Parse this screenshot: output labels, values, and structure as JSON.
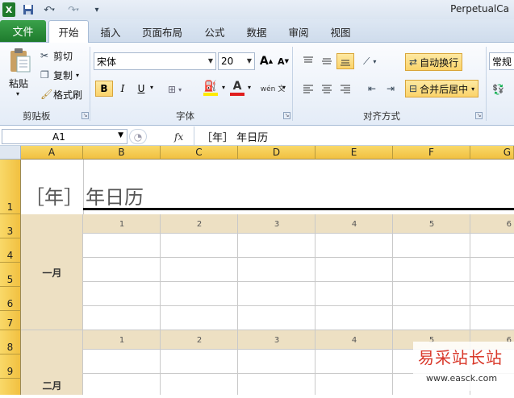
{
  "window": {
    "title": "PerpetualCa"
  },
  "qat": {
    "excel_icon": "excel-icon",
    "save_icon": "save-icon",
    "undo_icon": "undo-icon",
    "redo_icon": "redo-icon",
    "customize_icon": "customize-qat-icon"
  },
  "tabs": {
    "file": "文件",
    "items": [
      "开始",
      "插入",
      "页面布局",
      "公式",
      "数据",
      "审阅",
      "视图"
    ],
    "active": "开始"
  },
  "clipboard": {
    "paste": "粘贴",
    "cut": "剪切",
    "copy": "复制",
    "format_painter": "格式刷",
    "group": "剪贴板"
  },
  "font": {
    "name": "宋体",
    "size": "20",
    "grow": "A",
    "shrink": "A",
    "bold": "B",
    "italic": "I",
    "underline": "U",
    "font_color_letter": "A",
    "phonetic": "wén 文",
    "group": "字体"
  },
  "alignment": {
    "wrap_text": "自动换行",
    "merge_center": "合并后居中",
    "group": "对齐方式"
  },
  "number": {
    "format": "常规"
  },
  "formula_bar": {
    "name_box": "A1",
    "fx": "fx",
    "content": "［年］ 年日历"
  },
  "columns": [
    "A",
    "B",
    "C",
    "D",
    "E",
    "F",
    "G"
  ],
  "rows": [
    "1",
    "3",
    "4",
    "5",
    "6",
    "7",
    "8",
    "9"
  ],
  "sheet": {
    "title_bracket": "［年］",
    "title_text": "年日历",
    "day_numbers": [
      "1",
      "2",
      "3",
      "4",
      "5",
      "6"
    ],
    "months": [
      "一月",
      "二月"
    ]
  },
  "watermark": {
    "line1": "易采站长站",
    "line2": "www.easck.com"
  },
  "colors": {
    "accent_green": "#1e7b2d",
    "header_gold": "#f1c040",
    "tan": "#ede0c3",
    "watermark_red": "#d9382a"
  }
}
